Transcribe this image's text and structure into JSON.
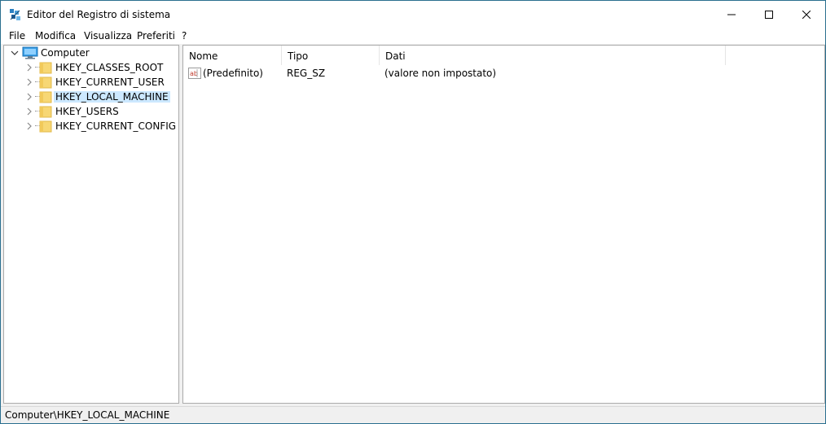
{
  "window": {
    "title": "Editor del Registro di sistema"
  },
  "menu": {
    "items": [
      "File",
      "Modifica",
      "Visualizza",
      "Preferiti",
      "?"
    ]
  },
  "tree": {
    "root": "Computer",
    "keys": [
      "HKEY_CLASSES_ROOT",
      "HKEY_CURRENT_USER",
      "HKEY_LOCAL_MACHINE",
      "HKEY_USERS",
      "HKEY_CURRENT_CONFIG"
    ],
    "selected": "HKEY_LOCAL_MACHINE"
  },
  "list": {
    "columns": [
      "Nome",
      "Tipo",
      "Dati"
    ],
    "rows": [
      {
        "name": "(Predefinito)",
        "type": "REG_SZ",
        "data": "(valore non impostato)"
      }
    ]
  },
  "status": {
    "path": "Computer\\HKEY_LOCAL_MACHINE"
  },
  "colors": {
    "selection": "#cce8ff",
    "folder": "#f7d774",
    "frame_border": "#2a6f8f"
  },
  "icons": {
    "app": "regedit-icon",
    "computer": "computer-icon",
    "folder": "folder-icon",
    "value": "string-value-icon"
  }
}
